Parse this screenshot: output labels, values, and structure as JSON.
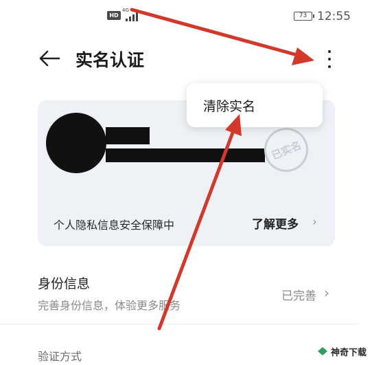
{
  "status_bar": {
    "hd_badge": "HD",
    "network": "4G",
    "battery_level": "73",
    "time": "12:55"
  },
  "header": {
    "back_icon": "arrow-left-icon",
    "title": "实名认证",
    "more_icon": "more-vertical-icon"
  },
  "popup_menu": {
    "items": [
      {
        "label": "清除实名"
      }
    ]
  },
  "identity_card": {
    "seal_text": "已实名",
    "privacy_note": "个人隐私信息安全保障中",
    "learn_more": "了解更多",
    "chevron_icon": "chevron-right-icon"
  },
  "identity_info": {
    "title": "身份信息",
    "subtitle": "完善身份信息，体验更多服务",
    "status": "已完善",
    "chevron_icon": "chevron-right-icon"
  },
  "verification": {
    "label": "验证方式"
  },
  "watermark": {
    "text": "神奇下载"
  },
  "colors": {
    "card_background": "#eef2f6",
    "annotation_arrow": "#d2392b",
    "muted_text": "#8a8a8a"
  }
}
